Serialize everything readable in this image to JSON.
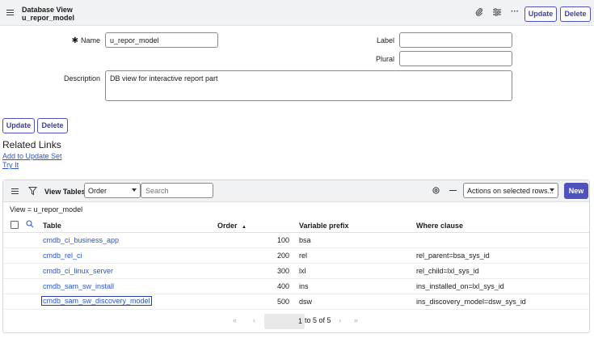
{
  "header": {
    "title": "Database View",
    "subtitle": "u_repor_model",
    "update_label": "Update",
    "delete_label": "Delete"
  },
  "form": {
    "name_label": "Name",
    "name_value": "u_repor_model",
    "label_label": "Label",
    "label_value": "",
    "plural_label": "Plural",
    "plural_value": "",
    "description_label": "Description",
    "description_value": "DB view for interactive report part"
  },
  "bottom_buttons": {
    "update_label": "Update",
    "delete_label": "Delete"
  },
  "related_links": {
    "title": "Related Links",
    "items": [
      "Add to Update Set",
      "Try It"
    ]
  },
  "list": {
    "title": "View Tables",
    "filter_field": "Order",
    "search_placeholder": "Search",
    "actions_label": "Actions on selected rows...",
    "new_label": "New",
    "breadcrumb": "View = u_repor_model",
    "columns": {
      "table": "Table",
      "order": "Order",
      "order_sort": "▲",
      "prefix": "Variable prefix",
      "where": "Where clause"
    },
    "rows": [
      {
        "table": "cmdb_ci_business_app",
        "order": "100",
        "prefix": "bsa",
        "where": ""
      },
      {
        "table": "cmdb_rel_ci",
        "order": "200",
        "prefix": "rel",
        "where": "rel_parent=bsa_sys_id"
      },
      {
        "table": "cmdb_ci_linux_server",
        "order": "300",
        "prefix": "lxl",
        "where": "rel_child=lxl_sys_id"
      },
      {
        "table": "cmdb_sam_sw_install",
        "order": "400",
        "prefix": "ins",
        "where": "ins_installed_on=lxl_sys_id"
      },
      {
        "table": "cmdb_sam_sw_discovery_model",
        "order": "500",
        "prefix": "dsw",
        "where": "ins_discovery_model=dsw_sys_id"
      }
    ],
    "pager": {
      "current": "1",
      "range_text": "to 5 of 5"
    }
  },
  "colors": {
    "accent": "#4f52bd",
    "link": "#2b55c9"
  },
  "icons": [
    "hamburger-icon",
    "paperclip-icon",
    "settings-sliders-icon",
    "more-icon",
    "filter-icon",
    "search-icon",
    "gear-icon",
    "minimize-icon",
    "first-page-icon",
    "prev-page-icon",
    "next-page-icon",
    "last-page-icon"
  ]
}
